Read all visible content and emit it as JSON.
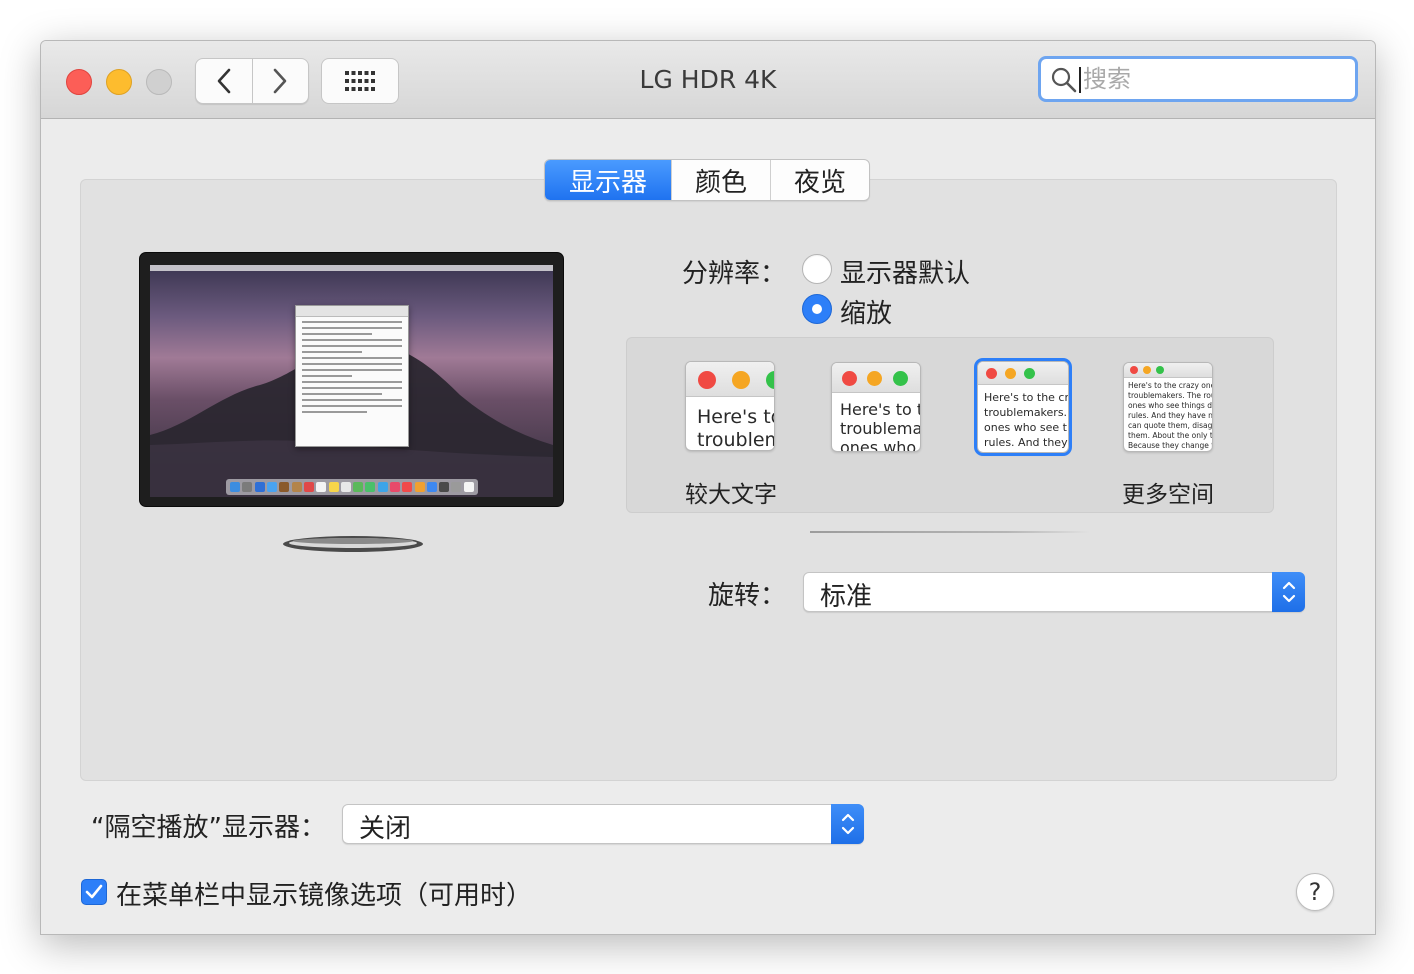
{
  "window": {
    "title": "LG HDR 4K"
  },
  "search": {
    "placeholder": "搜索",
    "value": ""
  },
  "tabs": [
    {
      "label": "显示器",
      "active": true
    },
    {
      "label": "颜色",
      "active": false
    },
    {
      "label": "夜览",
      "active": false
    }
  ],
  "resolution": {
    "label": "分辨率：",
    "options": [
      {
        "label": "显示器默认",
        "selected": false
      },
      {
        "label": "缩放",
        "selected": true
      }
    ]
  },
  "scaling": {
    "options": [
      {
        "preview_text": "Here's to\ntroublem",
        "selected": false
      },
      {
        "preview_text": "Here's to t\ntroublema\nones who",
        "selected": false
      },
      {
        "preview_text": "Here's to the cr\ntroublemakers.\nones who see t\nrules. And they",
        "selected": true
      },
      {
        "preview_text": "Here's to the crazy one\ntroublemakers. The rou\nones who see things dif\nrules. And they have no\ncan quote them, disagr\nthem. About the only th\nBecause they change th",
        "selected": false
      }
    ],
    "left_label": "较大文字",
    "right_label": "更多空间"
  },
  "rotation": {
    "label": "旋转：",
    "value": "标准"
  },
  "airplay": {
    "label": "“隔空播放”显示器：",
    "value": "关闭"
  },
  "mirroring": {
    "label": "在菜单栏中显示镜像选项（可用时）",
    "checked": true
  },
  "help": {
    "label": "?"
  },
  "colors": {
    "accent": "#2d7ff8",
    "close": "#fc5e57",
    "minimize": "#fdbc2e",
    "zoom": "#d0d0d0"
  }
}
